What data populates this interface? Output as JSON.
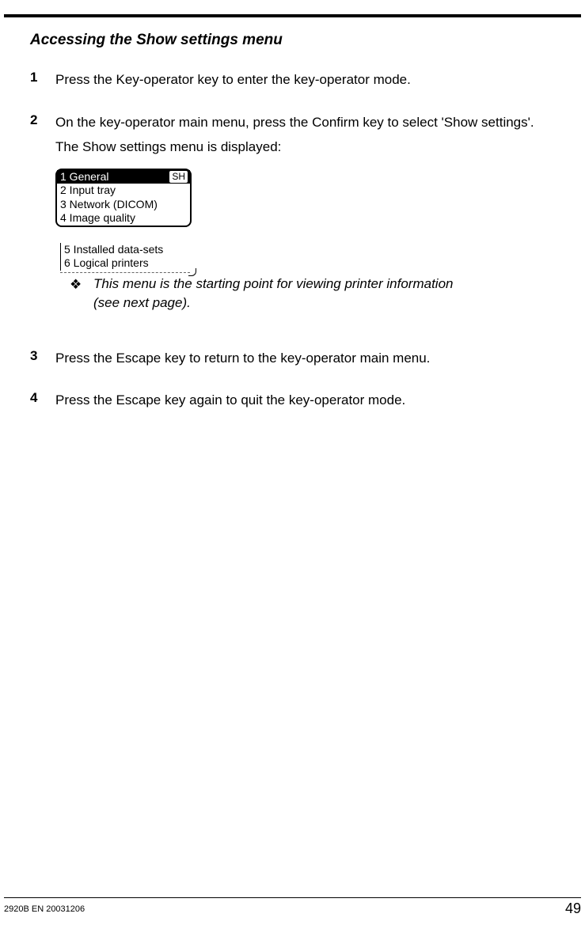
{
  "section_title": "Accessing the Show settings menu",
  "steps": {
    "s1": {
      "num": "1",
      "text": "Press the Key-operator key to enter the key-operator mode."
    },
    "s2": {
      "num": "2",
      "text1": "On the key-operator main menu, press the Confirm key to select 'Show settings'.",
      "text2": "The Show settings menu is displayed:"
    },
    "s3": {
      "num": "3",
      "text": "Press the Escape key to return to the key-operator main menu."
    },
    "s4": {
      "num": "4",
      "text": "Press the Escape key again to quit the key-operator mode."
    }
  },
  "menu": {
    "badge": "SH",
    "items": {
      "i1": "1 General",
      "i2": "2 Input tray",
      "i3": "3 Network (DICOM)",
      "i4": "4 Image quality",
      "i5": "5 Installed data-sets",
      "i6": "6 Logical printers"
    }
  },
  "note": {
    "bullet": "❖",
    "line1": "This menu is the starting point for viewing printer information",
    "line2": "(see next page)."
  },
  "footer": {
    "left": "2920B EN 20031206",
    "right": "49"
  }
}
